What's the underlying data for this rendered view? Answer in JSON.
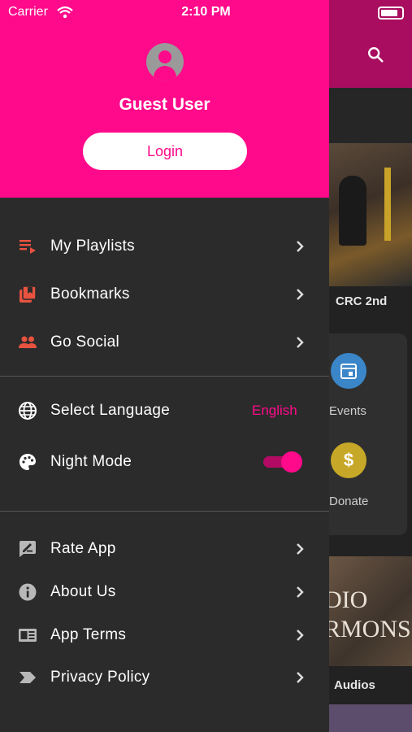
{
  "status_bar": {
    "carrier": "Carrier",
    "time": "2:10 PM"
  },
  "drawer": {
    "user_name": "Guest User",
    "login_label": "Login",
    "section1": [
      {
        "label": "My Playlists",
        "icon": "playlist-icon"
      },
      {
        "label": "Bookmarks",
        "icon": "bookmarks-icon"
      },
      {
        "label": "Go Social",
        "icon": "people-icon"
      }
    ],
    "section2": {
      "language_label": "Select Language",
      "language_value": "English",
      "night_mode_label": "Night Mode",
      "night_mode_on": true
    },
    "section3": [
      {
        "label": "Rate App",
        "icon": "rate-icon"
      },
      {
        "label": "About Us",
        "icon": "info-icon"
      },
      {
        "label": "App Terms",
        "icon": "terms-icon"
      },
      {
        "label": "Privacy Policy",
        "icon": "privacy-icon"
      }
    ]
  },
  "background": {
    "video_caption": "CRC 2nd",
    "events_label": "Events",
    "donate_label": "Donate",
    "donate_symbol": "$",
    "audio_banner_text": "DIO\nRMONS",
    "audios_label": "Audios"
  },
  "colors": {
    "accent": "#ff0a8a",
    "icon_red": "#e8533f",
    "drawer_bg": "#2b2b2b"
  }
}
